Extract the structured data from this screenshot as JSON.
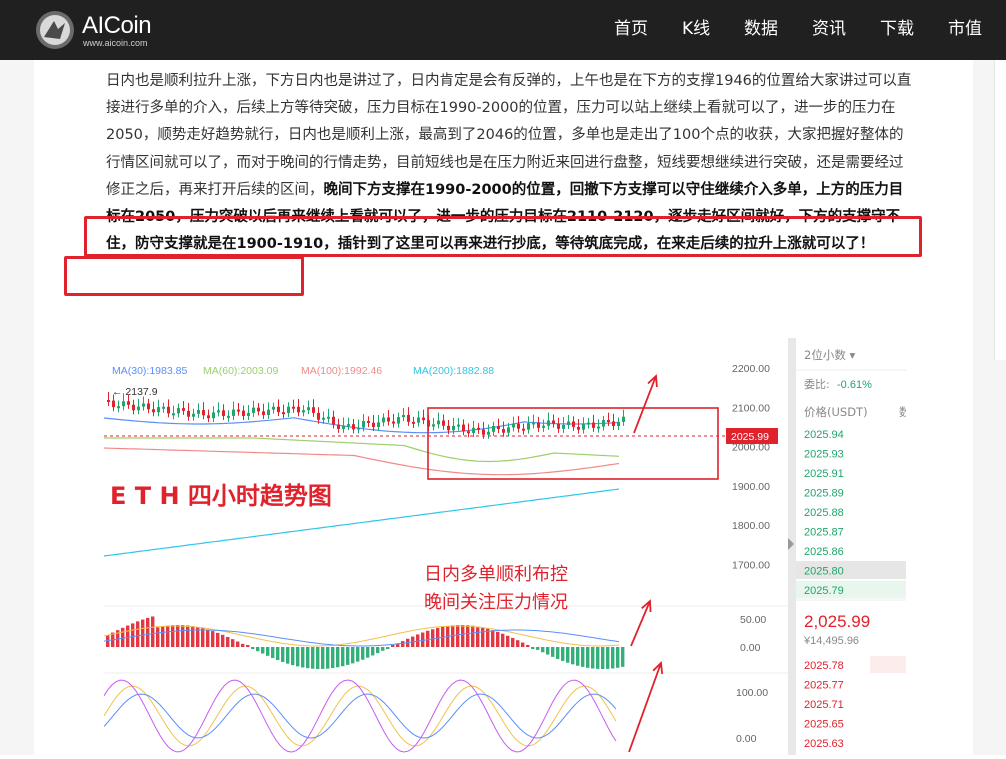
{
  "header": {
    "brand": "AICoin",
    "brand_url": "www.aicoin.com",
    "nav": [
      "首页",
      "K线",
      "数据",
      "资讯",
      "下载",
      "市值"
    ]
  },
  "article": {
    "normal_text": "日内也是顺利拉升上涨，下方日内也是讲过了，日内肯定是会有反弹的，上午也是在下方的支撑1946的位置给大家讲过可以直接进行多单的介入，后续上方等待突破，压力目标在1990-2000的位置，压力可以站上继续上看就可以了，进一步的压力在2050，顺势走好趋势就行，日内也是顺利上涨，最高到了2046的位置，多单也是走出了100个点的收获，大家把握好整体的行情区间就可以了，而对于晚间的行情走势，目前短线也是在压力附近来回进行盘整，短线要想继续进行突破，还是需要经过修正之后，再来打开后续的区间，",
    "bold_text": "晚间下方支撑在1990-2000的位置，回撤下方支撑可以守住继续介入多单，上方的压力目标在2050，压力突破以后再来继续上看就可以了，进一步的压力目标在2110-2120，逐步走好区间就好，下方的支撑守不住，防守支撑就是在1900-1910，插针到了这里可以再来进行抄底，等待筑底完成，在来走后续的拉升上涨就可以了！"
  },
  "chart": {
    "ma_legend": [
      {
        "label": "MA(30):1983.85",
        "color": "#5b8ff9"
      },
      {
        "label": "MA(60):2003.09",
        "color": "#9bd06a"
      },
      {
        "label": "MA(100):1992.46",
        "color": "#f08a8a"
      },
      {
        "label": "MA(200):1882.88",
        "color": "#2ec7e6"
      }
    ],
    "high_marker": "2137.9",
    "current_price_tag": "2025.99",
    "price_axis": [
      "2200.00",
      "2100.00",
      "2000.00",
      "1900.00",
      "1800.00",
      "1700.00"
    ],
    "indicator_axis_1": [
      "50.00",
      "0.00"
    ],
    "indicator_axis_2": [
      "100.00",
      "0.00"
    ],
    "annotation_title": "E T H 四小时趋势图",
    "annotation_note_1": "日内多单顺利布控",
    "annotation_note_2": "晚间关注压力情况",
    "colors": {
      "up": "#1fa66a",
      "down": "#e0222c",
      "annotation": "#e0222c"
    }
  },
  "orderbook": {
    "precision": "2位小数",
    "ratio_label": "委比:",
    "ratio_value": "-0.61%",
    "price_header": "价格(USDT)",
    "side_header_partial": "数",
    "asks": [
      "2025.94",
      "2025.93",
      "2025.91",
      "2025.89",
      "2025.88",
      "2025.87",
      "2025.86",
      "2025.80",
      "2025.79"
    ],
    "last_price": "2,025.99",
    "last_cny": "¥14,495.96",
    "bids": [
      "2025.78",
      "2025.77",
      "2025.71",
      "2025.65",
      "2025.63"
    ]
  }
}
